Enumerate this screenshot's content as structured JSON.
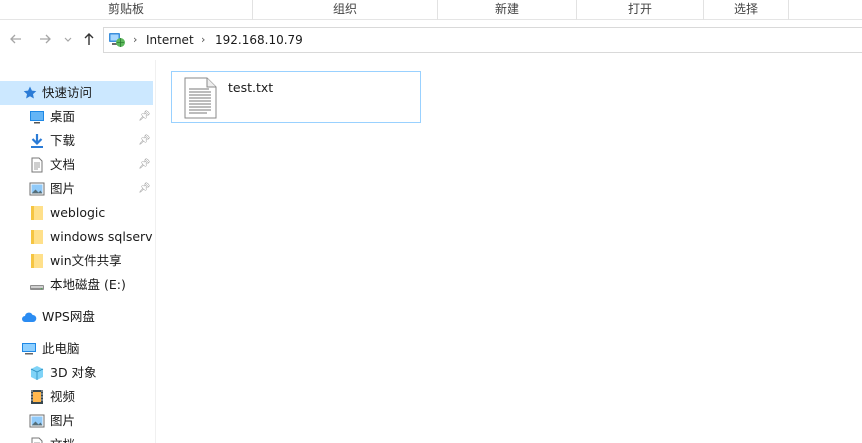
{
  "ribbon": {
    "groups": [
      "剪贴板",
      "组织",
      "新建",
      "打开",
      "选择"
    ]
  },
  "nav": {
    "back_icon": "arrow-left-icon",
    "forward_icon": "arrow-right-icon",
    "recent_icon": "chevron-down-icon",
    "up_icon": "arrow-up-icon"
  },
  "address": {
    "crumbs": [
      "Internet",
      "192.168.10.79"
    ]
  },
  "sidebar": {
    "items": [
      {
        "label": "快速访问",
        "icon": "star-icon"
      },
      {
        "label": "桌面",
        "icon": "desktop-icon",
        "pinned": true
      },
      {
        "label": "下载",
        "icon": "download-icon",
        "pinned": true
      },
      {
        "label": "文档",
        "icon": "document-icon",
        "pinned": true
      },
      {
        "label": "图片",
        "icon": "picture-icon",
        "pinned": true
      },
      {
        "label": "weblogic",
        "icon": "folder-icon"
      },
      {
        "label": "windows sqlserve",
        "icon": "folder-icon"
      },
      {
        "label": "win文件共享",
        "icon": "folder-icon"
      },
      {
        "label": "本地磁盘 (E:)",
        "icon": "drive-icon"
      },
      {
        "label": "WPS网盘",
        "icon": "cloud-icon"
      },
      {
        "label": "此电脑",
        "icon": "computer-icon"
      },
      {
        "label": "3D 对象",
        "icon": "cube-icon"
      },
      {
        "label": "视频",
        "icon": "video-icon"
      },
      {
        "label": "图片",
        "icon": "picture-icon"
      },
      {
        "label": "文档",
        "icon": "document-icon"
      }
    ]
  },
  "files": [
    {
      "name": "test.txt",
      "icon": "text-file-icon"
    }
  ],
  "colors": {
    "selection_bg": "#cce8ff",
    "tile_border": "#99d1ff",
    "folder": "#ffd766",
    "accent": "#0078d7"
  }
}
